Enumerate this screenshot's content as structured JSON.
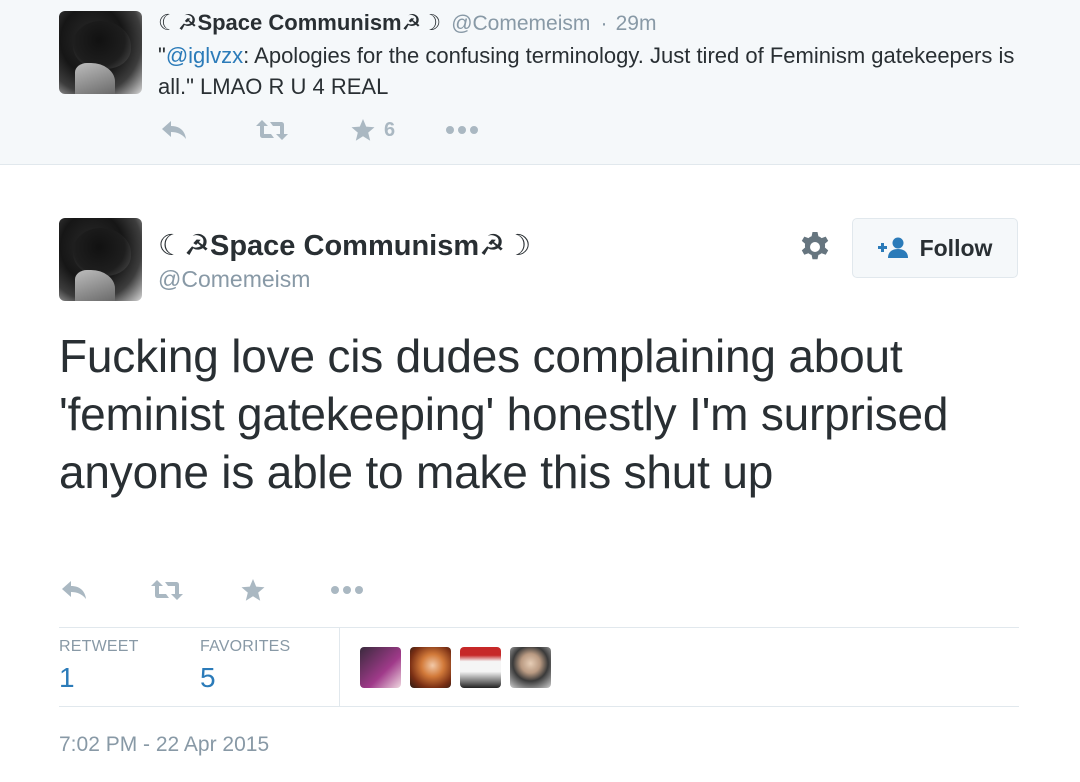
{
  "reply_tweet": {
    "name": "☾☭Space Communism☭☽",
    "handle": "@Comemeism",
    "separator": "·",
    "time": "29m",
    "quote_open": "\"",
    "mention": "@iglvzx",
    "text": ": Apologies for the confusing terminology. Just tired of Feminism gatekeepers is all.\" LMAO R U 4 REAL",
    "favorite_count": "6"
  },
  "main_tweet": {
    "name": "☾☭Space Communism☭☽",
    "handle": "@Comemeism",
    "follow_label": "Follow",
    "text": "Fucking love cis dudes complaining about 'feminist gatekeeping' honestly I'm surprised anyone is able to make this shut up",
    "stats": {
      "retweet_label": "RETWEET",
      "retweet_count": "1",
      "favorites_label": "FAVORITES",
      "favorites_count": "5"
    },
    "timestamp": "7:02 PM - 22 Apr 2015"
  },
  "icons": [
    "reply-icon",
    "retweet-icon",
    "favorite-icon",
    "more-icon",
    "gear-icon",
    "follow-person-icon"
  ],
  "colors": {
    "link": "#2b7bb9",
    "muted": "#8899a6",
    "icon": "#aab8c2",
    "text": "#292f33",
    "context_bg": "#f5f8fa",
    "border": "#e1e8ed"
  }
}
